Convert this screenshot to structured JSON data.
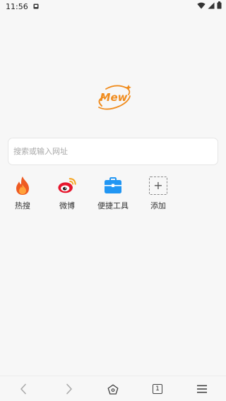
{
  "status_bar": {
    "time": "11:56",
    "notification_icon": "picture-notification-icon",
    "wifi_icon": "wifi-icon",
    "signal_icon": "cell-signal-icon",
    "battery_icon": "battery-icon"
  },
  "logo": {
    "text": "Mew",
    "color": "#f08c1e"
  },
  "search": {
    "placeholder": "搜索或输入网址",
    "value": ""
  },
  "quick_access": [
    {
      "label": "热搜",
      "icon": "flame-icon"
    },
    {
      "label": "微博",
      "icon": "weibo-icon"
    },
    {
      "label": "便捷工具",
      "icon": "toolbox-icon"
    },
    {
      "label": "添加",
      "icon": "add-icon"
    }
  ],
  "bottom_bar": {
    "back_icon": "back-arrow-icon",
    "forward_icon": "forward-arrow-icon",
    "home_icon": "home-icon",
    "tab_count": "1",
    "menu_icon": "menu-icon"
  },
  "colors": {
    "accent": "#f08c1e",
    "tool_blue": "#2196f3",
    "weibo_red": "#e6162d",
    "background": "#f7f7f7"
  }
}
